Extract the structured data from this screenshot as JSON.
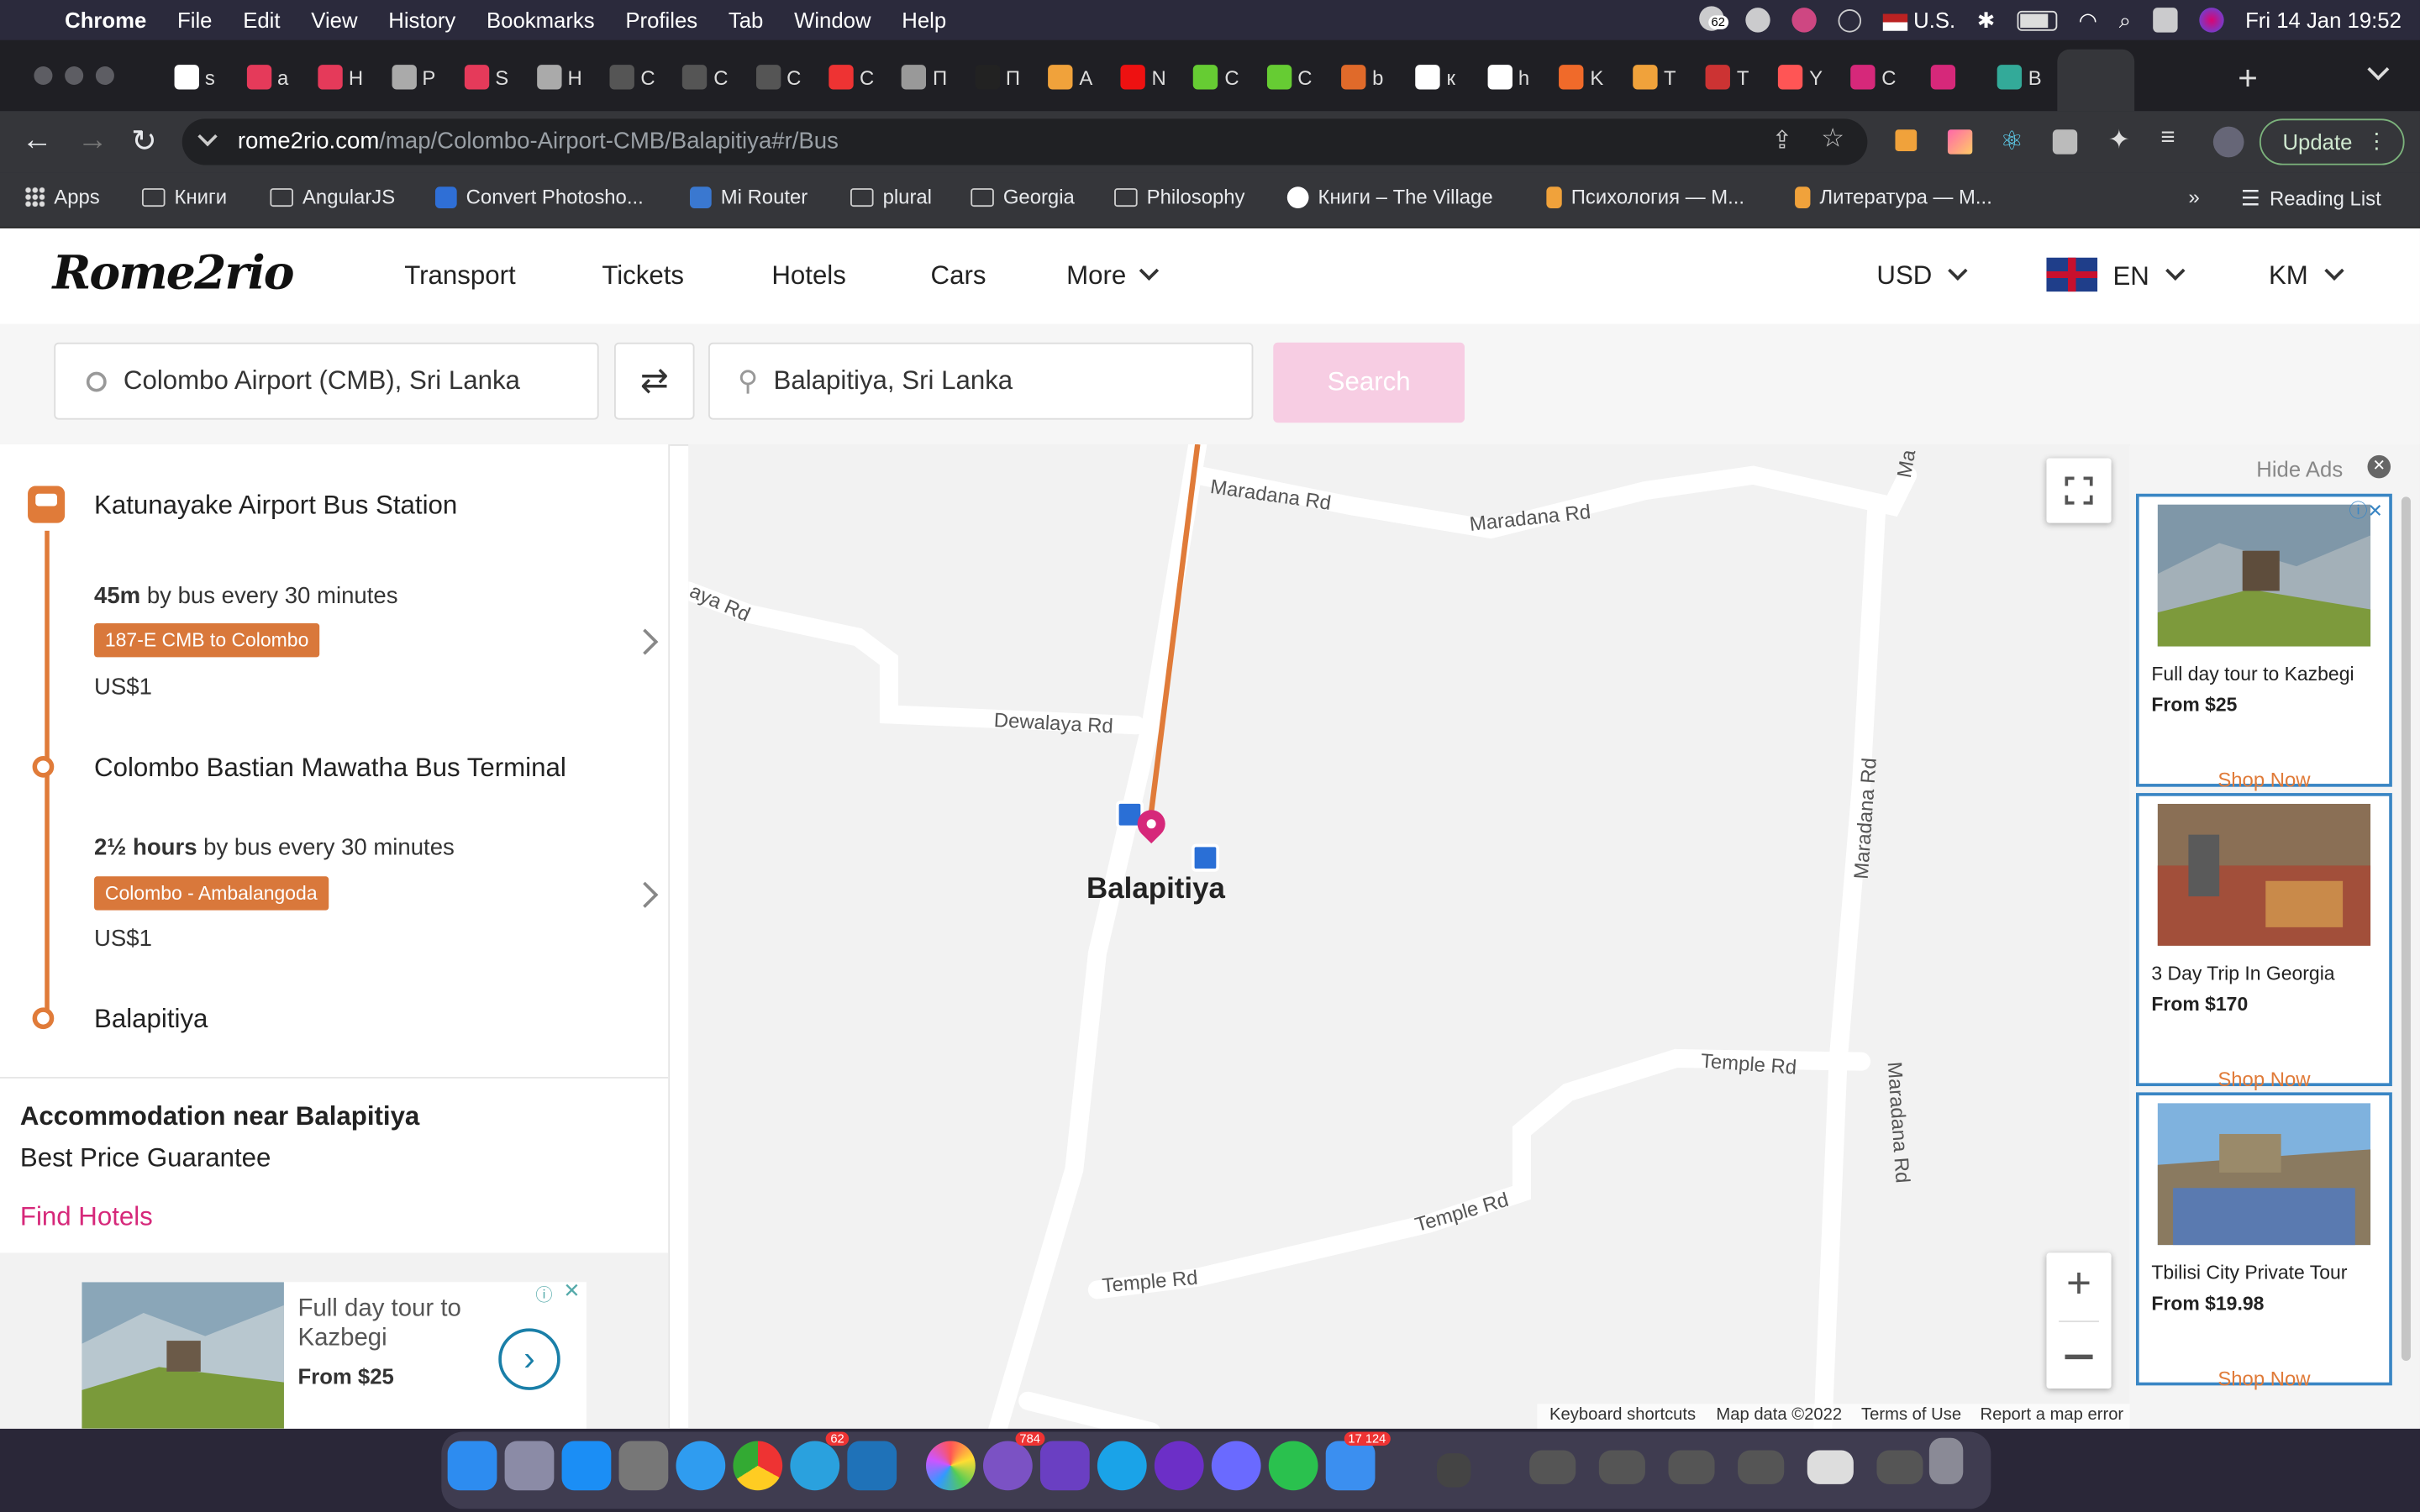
{
  "menubar": {
    "app": "Chrome",
    "items": [
      "File",
      "Edit",
      "View",
      "History",
      "Bookmarks",
      "Profiles",
      "Tab",
      "Window",
      "Help"
    ],
    "badge_count": "62",
    "locale": "U.S.",
    "datetime": "Fri 14 Jan  19:52"
  },
  "tabs": [
    {
      "label": "s"
    },
    {
      "label": "a"
    },
    {
      "label": "H"
    },
    {
      "label": "P"
    },
    {
      "label": "S"
    },
    {
      "label": "H"
    },
    {
      "label": "C"
    },
    {
      "label": "C"
    },
    {
      "label": "C"
    },
    {
      "label": "C"
    },
    {
      "label": "П"
    },
    {
      "label": "П"
    },
    {
      "label": "A"
    },
    {
      "label": "N"
    },
    {
      "label": "C"
    },
    {
      "label": "C"
    },
    {
      "label": "b"
    },
    {
      "label": "к"
    },
    {
      "label": "h"
    },
    {
      "label": "K"
    },
    {
      "label": "T"
    },
    {
      "label": "T"
    },
    {
      "label": "Y"
    },
    {
      "label": "C"
    },
    {
      "label": ""
    },
    {
      "label": "B"
    }
  ],
  "toolbar": {
    "url_host": "rome2rio.com",
    "url_path": "/map/Colombo-Airport-CMB/Balapitiya#r/Bus",
    "update_label": "Update"
  },
  "bookmarks": {
    "items": [
      "Apps",
      "Книги",
      "AngularJS",
      "Convert Photosho...",
      "Mi Router",
      "plural",
      "Georgia",
      "Philosophy",
      "Книги – The Village",
      "Психология — M...",
      "Литература — M..."
    ],
    "more": "»",
    "reading_list": "Reading List"
  },
  "site": {
    "logo": "Rome2rio",
    "nav": [
      "Transport",
      "Tickets",
      "Hotels",
      "Cars",
      "More"
    ],
    "currency": "USD",
    "language": "EN",
    "units": "KM"
  },
  "search": {
    "from": "Colombo Airport (CMB), Sri Lanka",
    "to": "Balapitiya, Sri Lanka",
    "button": "Search"
  },
  "route": {
    "stop1": "Katunayake Airport Bus Station",
    "seg1_duration": "45m",
    "seg1_desc": " by bus every 30 minutes",
    "seg1_line": "187-E CMB to Colombo",
    "seg1_price": "US$1",
    "stop2": "Colombo Bastian Mawatha Bus Terminal",
    "seg2_duration": "2½ hours",
    "seg2_desc": " by bus every 30 minutes",
    "seg2_line": "Colombo - Ambalangoda",
    "seg2_price": "US$1",
    "stop3": "Balapitiya"
  },
  "accommodation": {
    "title": "Accommodation near Balapitiya",
    "subtitle": "Best Price Guarantee",
    "link": "Find Hotels"
  },
  "inline_ad": {
    "title": "Full day tour to Kazbegi",
    "price": "From $25"
  },
  "map": {
    "place_label": "Balapitiya",
    "roads": [
      "Maradana Rd",
      "Maradana Rd",
      "Dewalaya Rd",
      "aya Rd",
      "Maradana Rd",
      "Temple Rd",
      "Maradana Rd",
      "Temple Rd",
      "Temple Rd",
      "Ma"
    ],
    "footer": [
      "Keyboard shortcuts",
      "Map data ©2022",
      "Terms of Use",
      "Report a map error"
    ]
  },
  "ads": {
    "hide": "Hide Ads",
    "cards": [
      {
        "title": "Full day tour to Kazbegi",
        "price": "From $25",
        "cta": "Shop Now"
      },
      {
        "title": "3 Day Trip In Georgia",
        "price": "From $170",
        "cta": "Shop Now"
      },
      {
        "title": "Tbilisi City Private Tour",
        "price": "From $19.98",
        "cta": "Shop Now"
      }
    ]
  },
  "dock": {
    "badges": [
      "62",
      "784",
      "17 124"
    ]
  },
  "colors": {
    "accent": "#e07b39",
    "brand_pink": "#d6287a",
    "ad_border": "#3a86c4"
  }
}
